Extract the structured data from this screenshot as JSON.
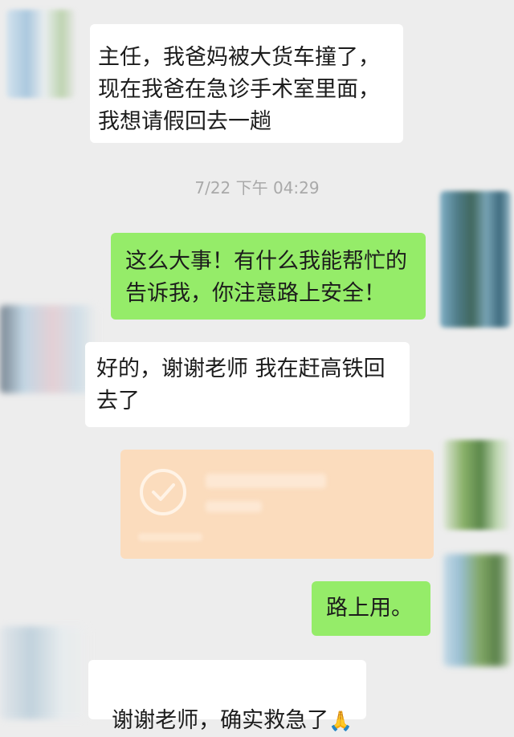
{
  "messages": [
    {
      "from": "other",
      "text": "主任，我爸妈被大货车撞了，\n现在我爸在急诊手术室里面，\n我想请假回去一趟"
    },
    {
      "from": "me",
      "text": "这么大事！有什么我能帮忙的\n告诉我，你注意路上安全！"
    },
    {
      "from": "other",
      "text": "好的，谢谢老师 我在赶高铁回\n去了"
    },
    {
      "from": "me",
      "text": "路上用。"
    },
    {
      "from": "other",
      "text": "谢谢老师，确实救急了"
    }
  ],
  "timestamp": "7/22 下午 04:29",
  "transfer": {
    "icon": "check-circle-icon",
    "color": "#fbdcbd"
  },
  "emoji": "🙏",
  "colors": {
    "background": "#ededed",
    "incoming": "#ffffff",
    "outgoing": "#95ec69"
  }
}
